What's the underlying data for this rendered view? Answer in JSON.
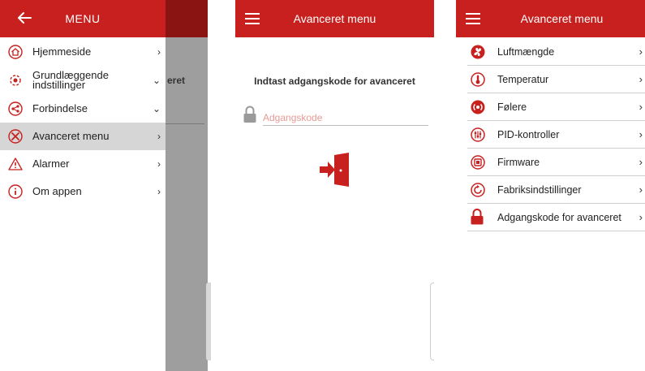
{
  "colors": {
    "brand_red": "#c7201e",
    "placeholder_pink": "#e79a96"
  },
  "screen1": {
    "header": {
      "back_icon": "arrow-left-icon",
      "title": "MENU"
    },
    "behind_text": "eret",
    "items": [
      {
        "label": "Hjemmeside",
        "icon": "home-icon",
        "chevron": "›"
      },
      {
        "label": "Grundlæggende\nindstillinger",
        "icon": "basic-settings-icon",
        "chevron": "⌄"
      },
      {
        "label": "Forbindelse",
        "icon": "share-icon",
        "chevron": "⌄"
      },
      {
        "label": "Avanceret menu",
        "icon": "tools-icon",
        "chevron": "›",
        "active": true
      },
      {
        "label": "Alarmer",
        "icon": "warning-icon",
        "chevron": "›"
      },
      {
        "label": "Om appen",
        "icon": "info-icon",
        "chevron": "›"
      }
    ]
  },
  "screen2": {
    "header": {
      "menu_icon": "hamburger-icon",
      "title": "Avanceret menu"
    },
    "prompt": "Indtast adgangskode for avanceret",
    "password": {
      "placeholder": "Adgangskode",
      "value": ""
    },
    "login_icon": "login-door-icon"
  },
  "screen3": {
    "header": {
      "menu_icon": "hamburger-icon",
      "title": "Avanceret menu"
    },
    "items": [
      {
        "label": "Luftmængde",
        "icon": "fan-icon"
      },
      {
        "label": "Temperatur",
        "icon": "thermometer-icon"
      },
      {
        "label": "Følere",
        "icon": "sensor-icon"
      },
      {
        "label": "PID-kontroller",
        "icon": "pid-controller-icon"
      },
      {
        "label": "Firmware",
        "icon": "firmware-icon"
      },
      {
        "label": "Fabriksindstillinger",
        "icon": "factory-reset-icon"
      },
      {
        "label": "Adgangskode for avanceret",
        "icon": "lock-icon"
      }
    ],
    "chevron": "›"
  }
}
